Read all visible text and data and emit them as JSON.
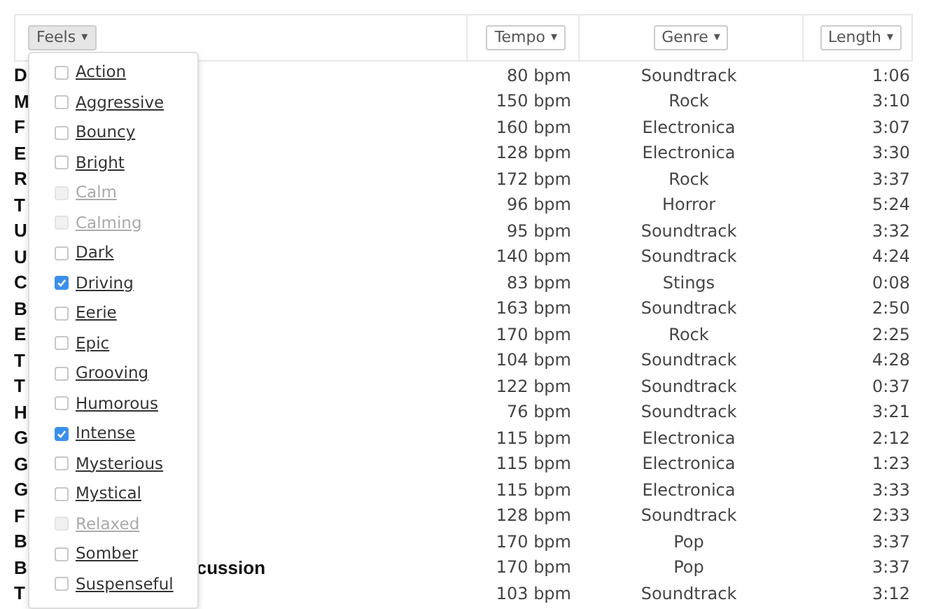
{
  "header": {
    "columns": [
      {
        "label": "Feels",
        "caret": "▾"
      },
      {
        "label": "Tempo",
        "caret": "▾"
      },
      {
        "label": "Genre",
        "caret": "▾"
      },
      {
        "label": "Length",
        "caret": "▾"
      }
    ]
  },
  "feels_menu": {
    "items": [
      {
        "label": "Action",
        "checked": false,
        "disabled": false
      },
      {
        "label": "Aggressive",
        "checked": false,
        "disabled": false
      },
      {
        "label": "Bouncy",
        "checked": false,
        "disabled": false
      },
      {
        "label": "Bright",
        "checked": false,
        "disabled": false
      },
      {
        "label": "Calm",
        "checked": false,
        "disabled": true
      },
      {
        "label": "Calming",
        "checked": false,
        "disabled": true
      },
      {
        "label": "Dark",
        "checked": false,
        "disabled": false
      },
      {
        "label": "Driving",
        "checked": true,
        "disabled": false
      },
      {
        "label": "Eerie",
        "checked": false,
        "disabled": false
      },
      {
        "label": "Epic",
        "checked": false,
        "disabled": false
      },
      {
        "label": "Grooving",
        "checked": false,
        "disabled": false
      },
      {
        "label": "Humorous",
        "checked": false,
        "disabled": false
      },
      {
        "label": "Intense",
        "checked": true,
        "disabled": false
      },
      {
        "label": "Mysterious",
        "checked": false,
        "disabled": false
      },
      {
        "label": "Mystical",
        "checked": false,
        "disabled": false
      },
      {
        "label": "Relaxed",
        "checked": false,
        "disabled": true
      },
      {
        "label": "Somber",
        "checked": false,
        "disabled": false
      },
      {
        "label": "Suspenseful",
        "checked": false,
        "disabled": false
      }
    ]
  },
  "tracks": [
    {
      "title": "D",
      "tempo": "80 bpm",
      "genre": "Soundtrack",
      "length": "1:06"
    },
    {
      "title": "M",
      "tempo": "150 bpm",
      "genre": "Rock",
      "length": "3:10"
    },
    {
      "title": "F",
      "tempo": "160 bpm",
      "genre": "Electronica",
      "length": "3:07"
    },
    {
      "title": "E",
      "tempo": "128 bpm",
      "genre": "Electronica",
      "length": "3:30"
    },
    {
      "title": "R",
      "tempo": "172 bpm",
      "genre": "Rock",
      "length": "3:37"
    },
    {
      "title": "T",
      "tempo": "96 bpm",
      "genre": "Horror",
      "length": "5:24"
    },
    {
      "title": "U",
      "tempo": "95 bpm",
      "genre": "Soundtrack",
      "length": "3:32"
    },
    {
      "title": "U",
      "tempo": "140 bpm",
      "genre": "Soundtrack",
      "length": "4:24"
    },
    {
      "title": "C",
      "tempo": "83 bpm",
      "genre": "Stings",
      "length": "0:08"
    },
    {
      "title": "B",
      "tempo": "163 bpm",
      "genre": "Soundtrack",
      "length": "2:50"
    },
    {
      "title": "E",
      "tempo": "170 bpm",
      "genre": "Rock",
      "length": "2:25"
    },
    {
      "title": "T",
      "tempo": "104 bpm",
      "genre": "Soundtrack",
      "length": "4:28"
    },
    {
      "title": "T",
      "tempo": "122 bpm",
      "genre": "Soundtrack",
      "length": "0:37"
    },
    {
      "title": "H",
      "tempo": "76 bpm",
      "genre": "Soundtrack",
      "length": "3:21"
    },
    {
      "title": "G",
      "tempo": "115 bpm",
      "genre": "Electronica",
      "length": "2:12"
    },
    {
      "title": "G",
      "tempo": "115 bpm",
      "genre": "Electronica",
      "length": "1:23"
    },
    {
      "title": "G",
      "tempo": "115 bpm",
      "genre": "Electronica",
      "length": "3:33"
    },
    {
      "title": "F",
      "tempo": "128 bpm",
      "genre": "Soundtrack",
      "length": "2:33"
    },
    {
      "title": "B",
      "tempo": "170 bpm",
      "genre": "Pop",
      "length": "3:37"
    },
    {
      "title": "B",
      "title_tail": "cussion",
      "tempo": "170 bpm",
      "genre": "Pop",
      "length": "3:37"
    },
    {
      "title": "T",
      "tempo": "103 bpm",
      "genre": "Soundtrack",
      "length": "3:12"
    }
  ]
}
